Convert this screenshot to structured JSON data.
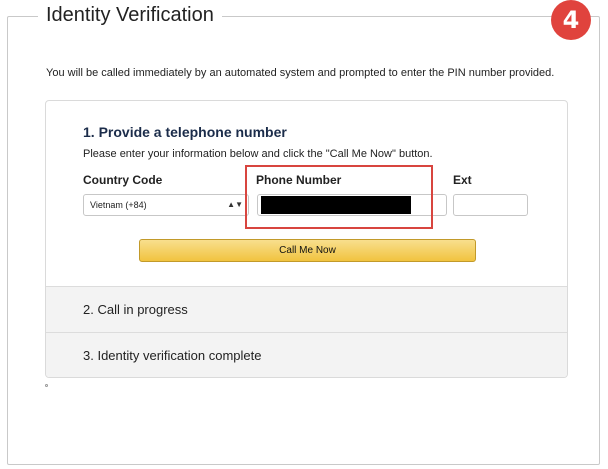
{
  "title": "Identity Verification",
  "badge": "4",
  "intro": "You will be called immediately by an automated system and prompted to enter the PIN number provided.",
  "step1": {
    "heading": "1. Provide a telephone number",
    "description": "Please enter your information below and click the \"Call Me Now\" button.",
    "country_label": "Country Code",
    "country_value": "Vietnam (+84)",
    "phone_label": "Phone Number",
    "ext_label": "Ext",
    "button_label": "Call Me Now"
  },
  "step2": {
    "heading": "2. Call in progress"
  },
  "step3": {
    "heading": "3. Identity verification complete"
  },
  "colors": {
    "badge": "#e0433d",
    "highlight": "#d8453f",
    "button": "#f1c33f",
    "heading": "#1b2c4a"
  }
}
